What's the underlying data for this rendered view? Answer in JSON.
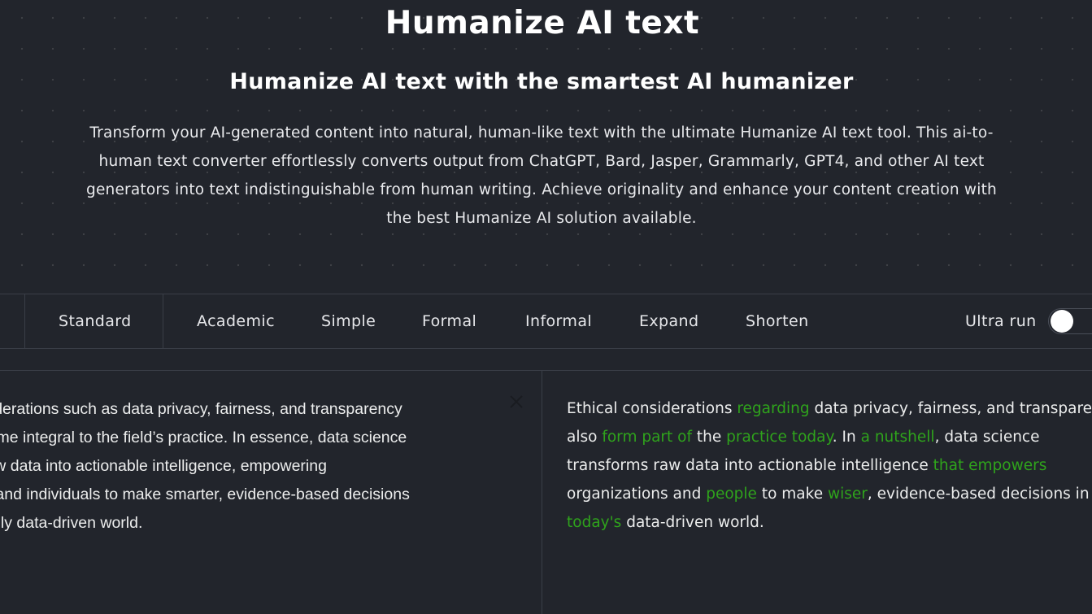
{
  "header": {
    "title": "Humanize AI text",
    "subtitle": "Humanize AI text with the smartest AI humanizer",
    "description_lines": [
      "Transform your AI-generated content into natural, human-like text with the ultimate Humanize AI text tool. This ai-to-",
      "human text converter effortlessly converts output from ChatGPT, Bard, Jasper, Grammarly, GPT4, and other AI text",
      "generators into text indistinguishable from human writing. Achieve originality and enhance your content creation with",
      "the best Humanize AI solution available."
    ]
  },
  "modes": {
    "tabs": [
      {
        "label": "Standard"
      },
      {
        "label": "Academic"
      },
      {
        "label": "Simple"
      },
      {
        "label": "Formal"
      },
      {
        "label": "Informal"
      },
      {
        "label": "Expand"
      },
      {
        "label": "Shorten"
      }
    ],
    "ultra_label": "Ultra run",
    "ultra_enabled": false
  },
  "input": {
    "lines": [
      "ical considerations such as data privacy, fairness, and transparency",
      "also become integral to the field’s practice. In essence, data science",
      "sforms raw data into actionable intelligence, empowering",
      "nizations and individuals to make smarter, evidence-based decisions",
      "increasingly data-driven world."
    ],
    "clear_icon": "close-icon"
  },
  "output": {
    "changed_color": "#2fa31c",
    "lines": [
      [
        {
          "text": "Ethical considerations ",
          "changed": false
        },
        {
          "text": "regarding",
          "changed": true
        },
        {
          "text": " data privacy, fairness, and transparency",
          "changed": false
        }
      ],
      [
        {
          "text": "also ",
          "changed": false
        },
        {
          "text": "form part of",
          "changed": true
        },
        {
          "text": " the ",
          "changed": false
        },
        {
          "text": "practice today",
          "changed": true
        },
        {
          "text": ". In ",
          "changed": false
        },
        {
          "text": "a nutshell",
          "changed": true
        },
        {
          "text": ", data science",
          "changed": false
        }
      ],
      [
        {
          "text": "transforms raw data into actionable intelligence ",
          "changed": false
        },
        {
          "text": "that empowers",
          "changed": true
        }
      ],
      [
        {
          "text": "organizations and ",
          "changed": false
        },
        {
          "text": "people",
          "changed": true
        },
        {
          "text": " to make ",
          "changed": false
        },
        {
          "text": "wiser",
          "changed": true
        },
        {
          "text": ", evidence-based decisions in",
          "changed": false
        }
      ],
      [
        {
          "text": "today's",
          "changed": true
        },
        {
          "text": " data-driven world.",
          "changed": false
        }
      ]
    ]
  }
}
